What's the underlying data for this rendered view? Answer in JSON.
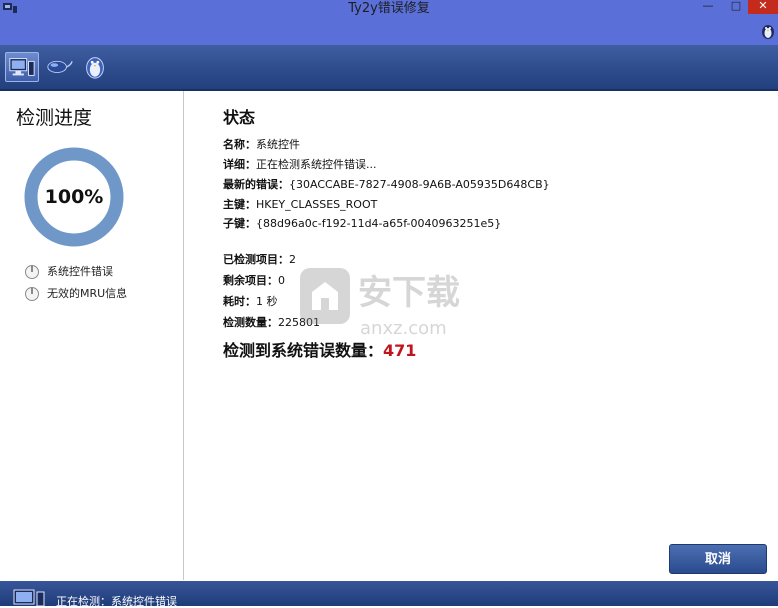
{
  "window": {
    "title": "Ty2y错误修复",
    "controls": {
      "minimize": "—",
      "maximize": "□",
      "close": "✕"
    }
  },
  "toolbar": {
    "buttons": [
      {
        "icon": "computer-scan-icon",
        "active": true
      },
      {
        "icon": "mouse-icon",
        "active": false
      },
      {
        "icon": "penguin-icon",
        "active": false
      }
    ]
  },
  "progress": {
    "heading": "检测进度",
    "percent_label": "100%",
    "percent_value": 100,
    "items": [
      "系统控件错误",
      "无效的MRU信息"
    ]
  },
  "status": {
    "heading": "状态",
    "name_key": "名称：",
    "name_val": "系统控件",
    "detail_key": "详细：",
    "detail_val": "正在检测系统控件错误...",
    "latest_key": "最新的错误：",
    "latest_val": "{30ACCABE-7827-4908-9A6B-A05935D648CB}",
    "mainkey_key": "主键：",
    "mainkey_val": "HKEY_CLASSES_ROOT",
    "subkey_key": "子键：",
    "subkey_val": "{88d96a0c-f192-11d4-a65f-0040963251e5}",
    "checked_key": "已检测项目：",
    "checked_val": "2",
    "remaining_key": "剩余项目：",
    "remaining_val": "0",
    "elapsed_key": "耗时：",
    "elapsed_val": "1 秒",
    "count_key": "检测数量：",
    "count_val": "225801",
    "total_label": "检测到系统错误数量：",
    "total_value": "471"
  },
  "watermark": {
    "text_cn": "安下载",
    "text_en": "anxz.com"
  },
  "actions": {
    "cancel": "取消"
  },
  "statusbar": {
    "text": "正在检测：系统控件错误"
  }
}
